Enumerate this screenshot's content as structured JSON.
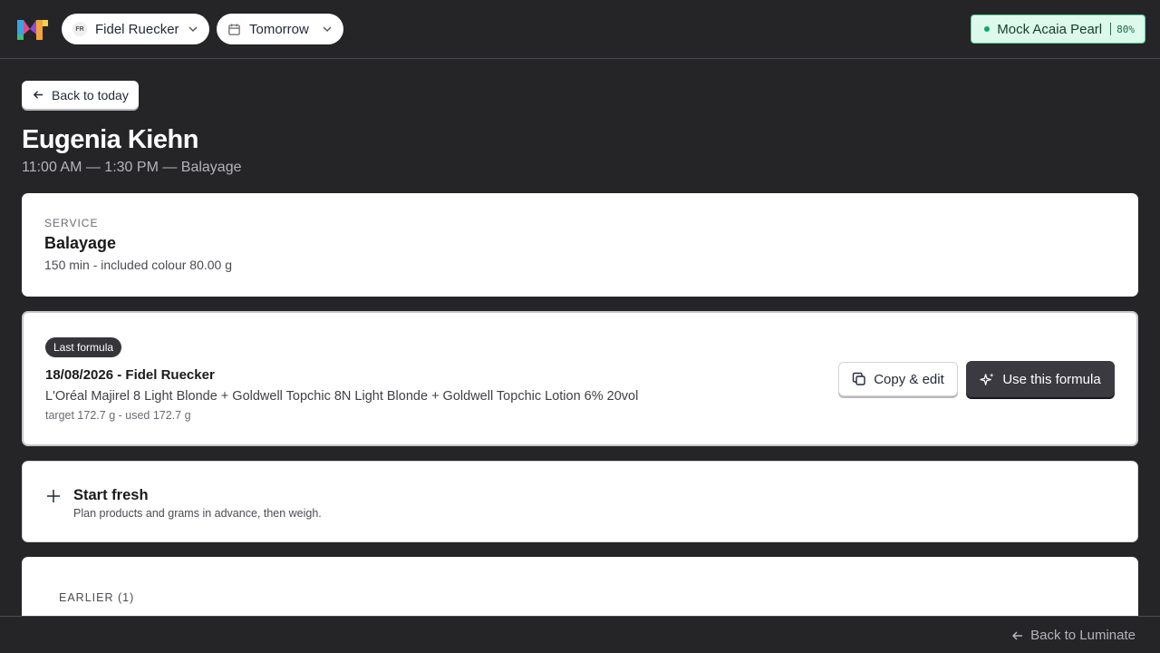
{
  "header": {
    "logo_icon": "luminate-logo-icon",
    "stylist": {
      "initials": "FR",
      "name": "Fidel Ruecker"
    },
    "date_selector": {
      "label": "Tomorrow",
      "icon": "calendar-icon"
    },
    "scale": {
      "name": "Mock Acaia Pearl",
      "battery": "80%",
      "status_color": "#12a669"
    }
  },
  "nav": {
    "back_label": "Back to today"
  },
  "appointment": {
    "client_name": "Eugenia Kiehn",
    "meta": "11:00 AM — 1:30 PM — Balayage"
  },
  "service": {
    "caption": "SERVICE",
    "name": "Balayage",
    "detail": "150 min - included colour 80.00 g"
  },
  "last_formula": {
    "badge": "Last formula",
    "date_stylist": "18/08/2026 - Fidel Ruecker",
    "products": "L'Oréal Majirel 8 Light Blonde + Goldwell Topchic 8N Light Blonde + Goldwell Topchic Lotion 6% 20vol",
    "usage": "target 172.7 g - used 172.7 g",
    "copy_label": "Copy & edit",
    "use_label": "Use this formula"
  },
  "start_fresh": {
    "title": "Start fresh",
    "subtitle": "Plan products and grams in advance, then weigh."
  },
  "earlier": {
    "label": "EARLIER (1)"
  },
  "footer": {
    "back_label": "Back to Luminate"
  },
  "colors": {
    "background": "#252528",
    "accent_dark": "#3a3a40",
    "scale_bg": "#dcfaec"
  }
}
